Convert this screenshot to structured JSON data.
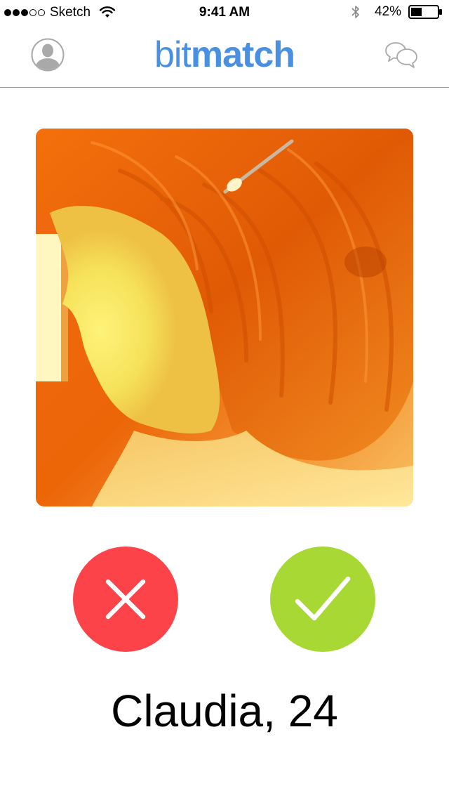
{
  "status_bar": {
    "carrier": "Sketch",
    "time": "9:41 AM",
    "battery": "42%",
    "signal_strength": 3,
    "signal_max": 5,
    "battery_level": 0.42
  },
  "nav": {
    "logo_light": "bit",
    "logo_bold": "match",
    "brand_color": "#4a90e2",
    "left_icon": "profile-icon",
    "right_icon": "chat-icon"
  },
  "profile": {
    "name_age": "Claudia, 24"
  },
  "actions": {
    "dislike_color": "#fc4349",
    "like_color": "#a8d834",
    "dislike_icon": "close-icon",
    "like_icon": "checkmark-icon"
  }
}
